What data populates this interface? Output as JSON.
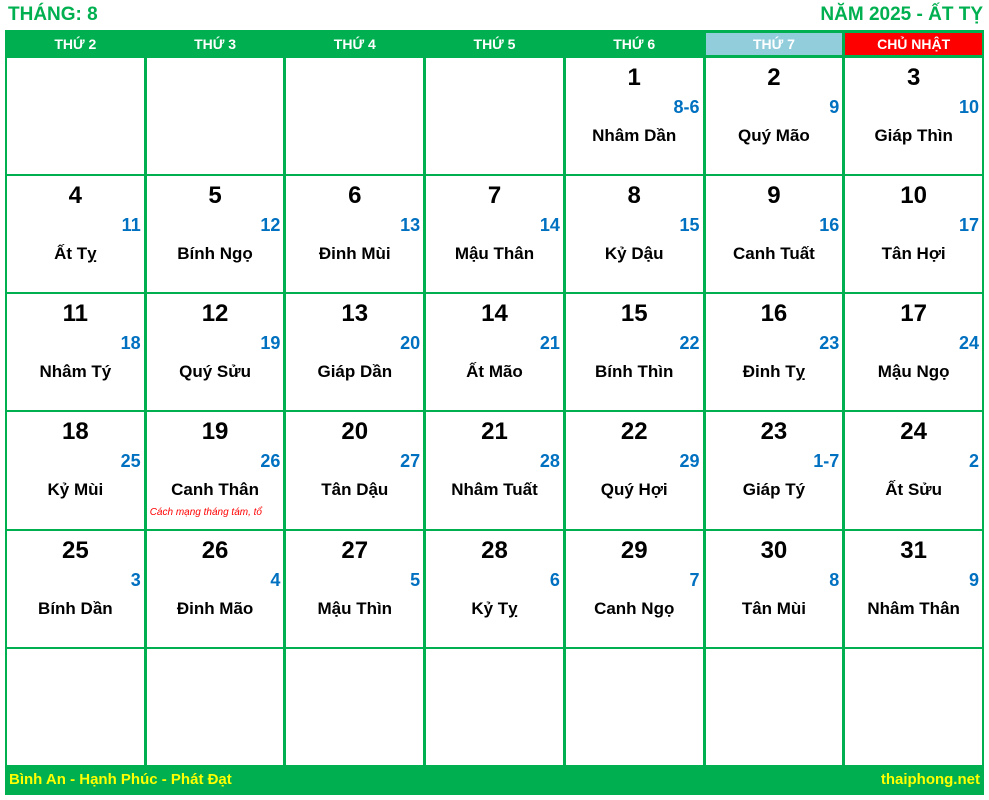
{
  "header": {
    "month": "THÁNG: 8",
    "year": "NĂM 2025 - ẤT TỴ"
  },
  "weekdays": [
    "THỨ 2",
    "THỨ 3",
    "THỨ 4",
    "THỨ 5",
    "THỨ 6",
    "THỨ 7",
    "CHỦ NHẬT"
  ],
  "colors": {
    "green": "#00b050",
    "saturday": "#92cddc",
    "sunday": "#ff0000",
    "lunar": "#0070c0",
    "note": "#ff0000",
    "footer_text": "#ffff00"
  },
  "weeks": [
    [
      null,
      null,
      null,
      null,
      {
        "solar": "1",
        "lunar": "8-6",
        "canchi": "Nhâm Dần"
      },
      {
        "solar": "2",
        "lunar": "9",
        "canchi": "Quý Mão"
      },
      {
        "solar": "3",
        "lunar": "10",
        "canchi": "Giáp Thìn"
      }
    ],
    [
      {
        "solar": "4",
        "lunar": "11",
        "canchi": "Ất Tỵ"
      },
      {
        "solar": "5",
        "lunar": "12",
        "canchi": "Bính Ngọ"
      },
      {
        "solar": "6",
        "lunar": "13",
        "canchi": "Đinh Mùi"
      },
      {
        "solar": "7",
        "lunar": "14",
        "canchi": "Mậu Thân"
      },
      {
        "solar": "8",
        "lunar": "15",
        "canchi": "Kỷ Dậu"
      },
      {
        "solar": "9",
        "lunar": "16",
        "canchi": "Canh Tuất"
      },
      {
        "solar": "10",
        "lunar": "17",
        "canchi": "Tân Hợi"
      }
    ],
    [
      {
        "solar": "11",
        "lunar": "18",
        "canchi": "Nhâm Tý"
      },
      {
        "solar": "12",
        "lunar": "19",
        "canchi": "Quý Sửu"
      },
      {
        "solar": "13",
        "lunar": "20",
        "canchi": "Giáp Dần"
      },
      {
        "solar": "14",
        "lunar": "21",
        "canchi": "Ất Mão"
      },
      {
        "solar": "15",
        "lunar": "22",
        "canchi": "Bính Thìn"
      },
      {
        "solar": "16",
        "lunar": "23",
        "canchi": "Đinh Tỵ"
      },
      {
        "solar": "17",
        "lunar": "24",
        "canchi": "Mậu Ngọ"
      }
    ],
    [
      {
        "solar": "18",
        "lunar": "25",
        "canchi": "Kỷ Mùi"
      },
      {
        "solar": "19",
        "lunar": "26",
        "canchi": "Canh Thân",
        "note": "Cách mạng tháng tám, tổ"
      },
      {
        "solar": "20",
        "lunar": "27",
        "canchi": "Tân Dậu"
      },
      {
        "solar": "21",
        "lunar": "28",
        "canchi": "Nhâm Tuất"
      },
      {
        "solar": "22",
        "lunar": "29",
        "canchi": "Quý Hợi"
      },
      {
        "solar": "23",
        "lunar": "1-7",
        "canchi": "Giáp Tý"
      },
      {
        "solar": "24",
        "lunar": "2",
        "canchi": "Ất Sửu"
      }
    ],
    [
      {
        "solar": "25",
        "lunar": "3",
        "canchi": "Bính Dần"
      },
      {
        "solar": "26",
        "lunar": "4",
        "canchi": "Đinh Mão"
      },
      {
        "solar": "27",
        "lunar": "5",
        "canchi": "Mậu Thìn"
      },
      {
        "solar": "28",
        "lunar": "6",
        "canchi": "Kỷ Tỵ"
      },
      {
        "solar": "29",
        "lunar": "7",
        "canchi": "Canh Ngọ"
      },
      {
        "solar": "30",
        "lunar": "8",
        "canchi": "Tân Mùi"
      },
      {
        "solar": "31",
        "lunar": "9",
        "canchi": "Nhâm Thân"
      }
    ],
    [
      null,
      null,
      null,
      null,
      null,
      null,
      null
    ]
  ],
  "footer": {
    "slogan": "Bình An - Hạnh Phúc - Phát Đạt",
    "site": "thaiphong.net"
  }
}
